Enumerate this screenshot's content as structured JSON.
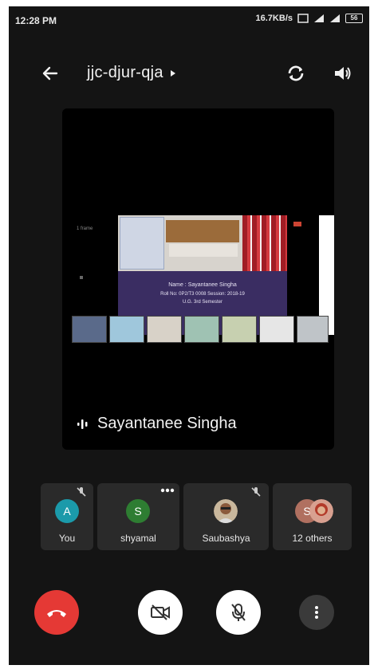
{
  "status_bar": {
    "time": "12:28 PM",
    "net_speed": "16.7KB/s",
    "battery": "56"
  },
  "app_bar": {
    "meeting_code": "jjc-djur-qja"
  },
  "main_tile": {
    "speaker_name": "Sayantanee Singha",
    "screen_share": {
      "side_label": "1 frame",
      "slide_line_1": "Name : Sayantanee Singha",
      "slide_line_2": "Roll No: 0P2/T3 0008 Session: 2018-19",
      "slide_line_3": "U.G. 3rd Semester"
    }
  },
  "participants": [
    {
      "name": "You",
      "initial": "A",
      "color": "#1b9aaa",
      "muted": true
    },
    {
      "name": "shyamal",
      "initial": "S",
      "color": "#2e7d32",
      "muted": false
    },
    {
      "name": "Saubashya",
      "initial": "",
      "color": "",
      "muted": true
    },
    {
      "name": "12 others",
      "initial": "S",
      "color": "#b07060",
      "muted": false
    }
  ],
  "colors": {
    "end_call": "#e53935",
    "background": "#141414",
    "tile": "#2a2a2a"
  }
}
